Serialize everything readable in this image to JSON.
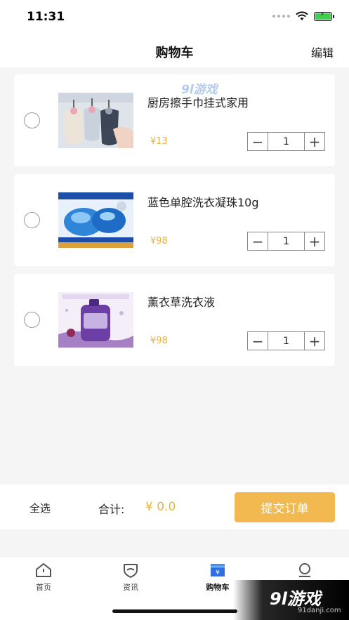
{
  "status_bar": {
    "time": "11:31"
  },
  "nav": {
    "title": "购物车",
    "edit": "编辑"
  },
  "watermark": {
    "top": "9l游戏",
    "corner": "9l游戏",
    "corner_url": "91danji.com"
  },
  "cart": {
    "items": [
      {
        "name": "厨房擦手巾挂式家用",
        "price": "¥13",
        "quantity": "1",
        "image": "hand-towels-image"
      },
      {
        "name": "蓝色单腔洗衣凝珠10g",
        "price": "¥98",
        "quantity": "1",
        "image": "laundry-pods-image"
      },
      {
        "name": "薰衣草洗衣液",
        "price": "¥98",
        "quantity": "1",
        "image": "lavender-detergent-image"
      }
    ],
    "minus_symbol": "−",
    "plus_symbol": "+"
  },
  "summary": {
    "select_all": "全选",
    "total_label": "合计:",
    "total_value": "¥ 0.0",
    "submit": "提交订单"
  },
  "tabs": [
    {
      "label": "首页",
      "icon": "home-icon",
      "active": false
    },
    {
      "label": "资讯",
      "icon": "news-shield-icon",
      "active": false
    },
    {
      "label": "购物车",
      "icon": "cart-yen-icon",
      "active": true
    },
    {
      "label": "",
      "icon": "user-icon",
      "active": false
    }
  ],
  "colors": {
    "accent": "#f2b950",
    "price": "#e9b342",
    "background": "#f5f5f5"
  }
}
